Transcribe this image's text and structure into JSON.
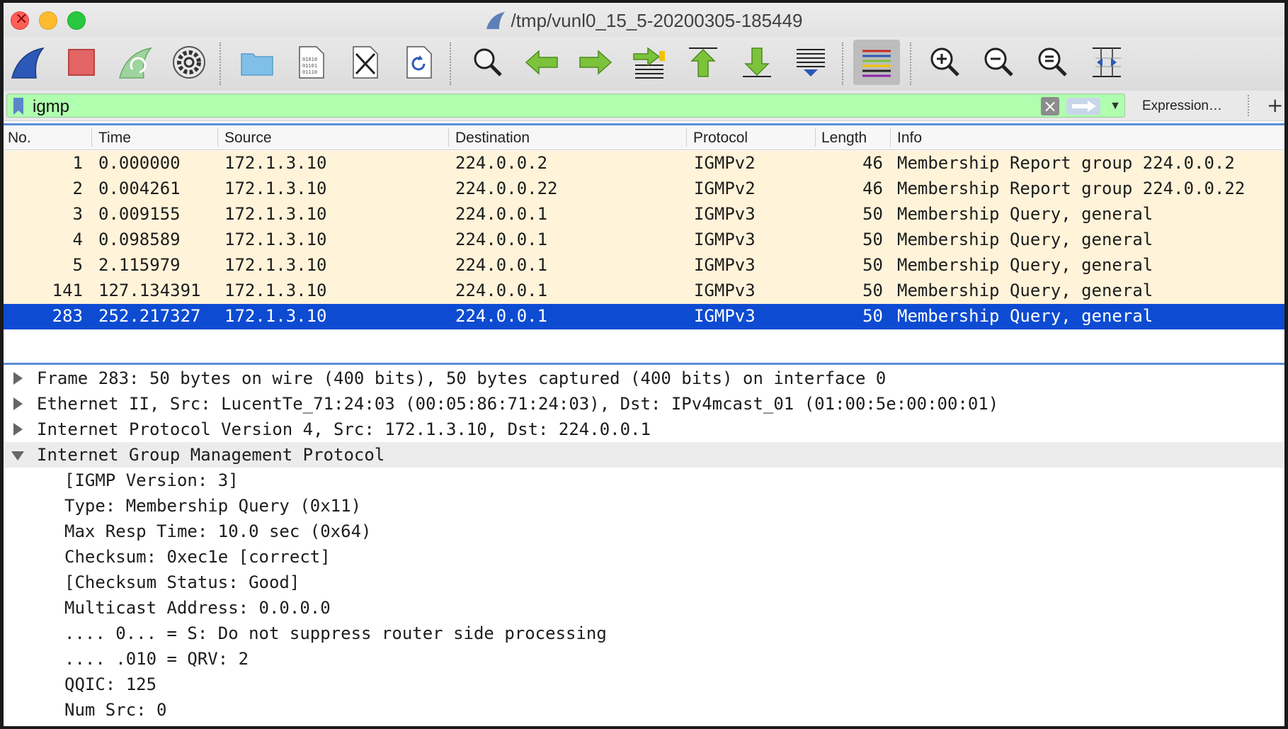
{
  "window": {
    "title": "/tmp/vunl0_15_5-20200305-185449"
  },
  "toolbar": {
    "buttons": [
      {
        "name": "start-capture",
        "icon": "shark-fin-icon"
      },
      {
        "name": "stop-capture",
        "icon": "stop-square-icon"
      },
      {
        "name": "restart-capture",
        "icon": "restart-fin-icon"
      },
      {
        "name": "capture-options",
        "icon": "gear-icon"
      },
      {
        "name": "open-file",
        "icon": "folder-icon"
      },
      {
        "name": "save-file",
        "icon": "binary-file-icon"
      },
      {
        "name": "close-file",
        "icon": "close-file-icon"
      },
      {
        "name": "reload-file",
        "icon": "reload-file-icon"
      },
      {
        "name": "find-packet",
        "icon": "magnifier-icon"
      },
      {
        "name": "go-back",
        "icon": "arrow-left-icon"
      },
      {
        "name": "go-forward",
        "icon": "arrow-right-icon"
      },
      {
        "name": "go-to-packet",
        "icon": "go-to-packet-icon"
      },
      {
        "name": "go-to-first",
        "icon": "arrow-up-first-icon"
      },
      {
        "name": "go-to-last",
        "icon": "arrow-down-last-icon"
      },
      {
        "name": "autoscroll",
        "icon": "autoscroll-icon"
      },
      {
        "name": "colorize",
        "icon": "colorize-lines-icon"
      },
      {
        "name": "zoom-in",
        "icon": "zoom-in-icon"
      },
      {
        "name": "zoom-out",
        "icon": "zoom-out-icon"
      },
      {
        "name": "normal-size",
        "icon": "zoom-reset-icon"
      },
      {
        "name": "resize-columns",
        "icon": "resize-columns-icon"
      }
    ]
  },
  "filter": {
    "value": "igmp",
    "expression_label": "Expression…",
    "add_label": "+"
  },
  "packet_list": {
    "columns": [
      "No.",
      "Time",
      "Source",
      "Destination",
      "Protocol",
      "Length",
      "Info"
    ],
    "rows": [
      {
        "no": "1",
        "time": "0.000000",
        "source": "172.1.3.10",
        "destination": "224.0.0.2",
        "protocol": "IGMPv2",
        "length": "46",
        "info": "Membership Report group 224.0.0.2"
      },
      {
        "no": "2",
        "time": "0.004261",
        "source": "172.1.3.10",
        "destination": "224.0.0.22",
        "protocol": "IGMPv2",
        "length": "46",
        "info": "Membership Report group 224.0.0.22"
      },
      {
        "no": "3",
        "time": "0.009155",
        "source": "172.1.3.10",
        "destination": "224.0.0.1",
        "protocol": "IGMPv3",
        "length": "50",
        "info": "Membership Query, general"
      },
      {
        "no": "4",
        "time": "0.098589",
        "source": "172.1.3.10",
        "destination": "224.0.0.1",
        "protocol": "IGMPv3",
        "length": "50",
        "info": "Membership Query, general"
      },
      {
        "no": "5",
        "time": "2.115979",
        "source": "172.1.3.10",
        "destination": "224.0.0.1",
        "protocol": "IGMPv3",
        "length": "50",
        "info": "Membership Query, general"
      },
      {
        "no": "141",
        "time": "127.134391",
        "source": "172.1.3.10",
        "destination": "224.0.0.1",
        "protocol": "IGMPv3",
        "length": "50",
        "info": "Membership Query, general"
      },
      {
        "no": "283",
        "time": "252.217327",
        "source": "172.1.3.10",
        "destination": "224.0.0.1",
        "protocol": "IGMPv3",
        "length": "50",
        "info": "Membership Query, general"
      }
    ],
    "selected_index": 6
  },
  "details": {
    "tree": [
      {
        "text": "Frame 283: 50 bytes on wire (400 bits), 50 bytes captured (400 bits) on interface 0",
        "level": 0,
        "state": "collapsed"
      },
      {
        "text": "Ethernet II, Src: LucentTe_71:24:03 (00:05:86:71:24:03), Dst: IPv4mcast_01 (01:00:5e:00:00:01)",
        "level": 0,
        "state": "collapsed"
      },
      {
        "text": "Internet Protocol Version 4, Src: 172.1.3.10, Dst: 224.0.0.1",
        "level": 0,
        "state": "collapsed"
      },
      {
        "text": "Internet Group Management Protocol",
        "level": 0,
        "state": "expanded"
      },
      {
        "text": "[IGMP Version: 3]",
        "level": 1
      },
      {
        "text": "Type: Membership Query (0x11)",
        "level": 1
      },
      {
        "text": "Max Resp Time: 10.0 sec (0x64)",
        "level": 1
      },
      {
        "text": "Checksum: 0xec1e [correct]",
        "level": 1
      },
      {
        "text": "[Checksum Status: Good]",
        "level": 1
      },
      {
        "text": "Multicast Address: 0.0.0.0",
        "level": 1
      },
      {
        "text": ".... 0... = S: Do not suppress router side processing",
        "level": 1
      },
      {
        "text": ".... .010 = QRV: 2",
        "level": 1
      },
      {
        "text": "QQIC: 125",
        "level": 1
      },
      {
        "text": "Num Src: 0",
        "level": 1
      }
    ]
  },
  "colors": {
    "filter_valid": "#afffaf",
    "row_bg": "#fff3d9",
    "row_selected": "#0d4bd2",
    "accent_divider": "#5b8ed6"
  }
}
